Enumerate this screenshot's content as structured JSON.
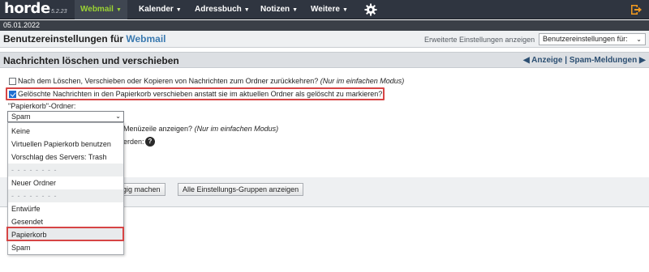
{
  "app": {
    "logo": "horde",
    "version": "5.2.23",
    "date": "05.01.2022"
  },
  "nav": [
    {
      "label": "Webmail",
      "active": true
    },
    {
      "label": "Kalender"
    },
    {
      "label": "Adressbuch"
    },
    {
      "label": "Notizen"
    },
    {
      "label": "Weitere"
    }
  ],
  "icons": {
    "settings": "gear-icon",
    "logout": "logout-icon",
    "help": "help-icon"
  },
  "header": {
    "title_prefix": "Benutzereinstellungen für ",
    "title_app": "Webmail",
    "advanced_link": "Erweiterte Einstellungen anzeigen",
    "group_select": "Benutzereinstellungen für:"
  },
  "section": {
    "title": "Nachrichten löschen und verschieben",
    "prev": "Anzeige",
    "separator": "|",
    "next": "Spam-Meldungen"
  },
  "options": {
    "return_to_folder": {
      "label": "Nach dem Löschen, Verschieben oder Kopieren von Nachrichten zum Ordner zurückkehren?",
      "note": "(Nur im einfachen Modus)",
      "checked": false
    },
    "move_to_trash": {
      "label": "Gelöschte Nachrichten in den Papierkorb verschieben anstatt sie im aktuellen Ordner als gelöscht zu markieren?",
      "checked": true
    },
    "trash_label": "\"Papierkorb\"-Ordner:",
    "trash_value": "Spam",
    "menu_partial": "Menüzeile anzeigen?",
    "menu_note": "(Nur im einfachen Modus)",
    "partial2": "erden:"
  },
  "dropdown": [
    {
      "label": "Keine"
    },
    {
      "label": "Virtuellen Papierkorb benutzen"
    },
    {
      "label": "Vorschlag des Servers: Trash"
    },
    {
      "label": "- - - - - - - -",
      "separator": true
    },
    {
      "label": "Neuer Ordner"
    },
    {
      "label": "- - - - - - - -",
      "separator": true
    },
    {
      "label": "Entwürfe"
    },
    {
      "label": "Gesendet"
    },
    {
      "label": "Papierkorb",
      "highlighted": true
    },
    {
      "label": "Spam"
    }
  ],
  "buttons": {
    "undo_partial": "ngig machen",
    "show_all_groups": "Alle Einstellungs-Gruppen anzeigen"
  },
  "colors": {
    "accent_nav": "#9bd334",
    "highlight_border": "#d64545",
    "checkbox": "#1f6fd1"
  }
}
